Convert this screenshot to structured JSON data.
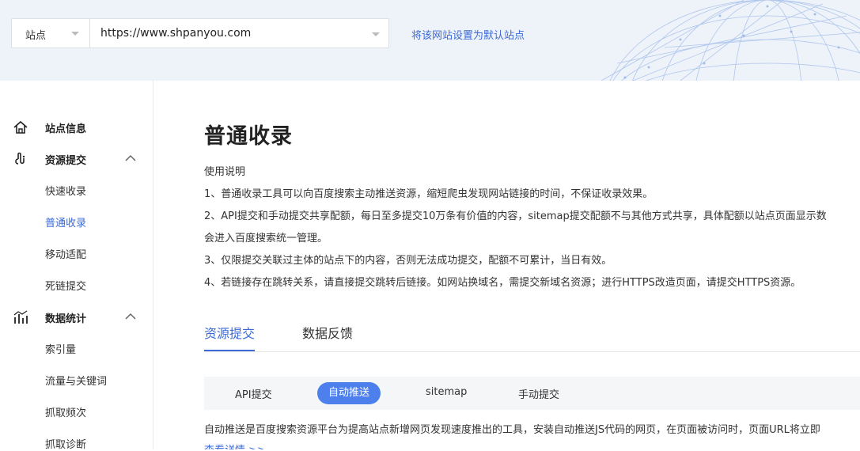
{
  "header": {
    "site_type": "站点",
    "site_url": "https://www.shpanyou.com",
    "set_default": "将该网站设置为默认站点"
  },
  "sidebar": {
    "site_info": "站点信息",
    "resource_submit": "资源提交",
    "resource_items": [
      "快速收录",
      "普通收录",
      "移动适配",
      "死链提交"
    ],
    "data_stats": "数据统计",
    "stats_items": [
      "索引量",
      "流量与关键词",
      "抓取频次",
      "抓取诊断"
    ]
  },
  "main": {
    "title": "普通收录",
    "instructions_title": "使用说明",
    "instructions": [
      "1、普通收录工具可以向百度搜索主动推送资源，缩短爬虫发现网站链接的时间，不保证收录效果。",
      "2、API提交和手动提交共享配额，每日至多提交10万条有价值的内容，sitemap提交配额不与其他方式共享，具体配额以站点页面显示数",
      "会进入百度搜索统一管理。",
      "3、仅限提交关联过主体的站点下的内容，否则无法成功提交，配额不可累计，当日有效。",
      "4、若链接存在跳转关系，请直接提交跳转后链接。如网站换域名，需提交新域名资源；进行HTTPS改造页面，请提交HTTPS资源。"
    ],
    "tabs": [
      "资源提交",
      "数据反馈"
    ],
    "subtabs": [
      "API提交",
      "自动推送",
      "sitemap",
      "手动提交"
    ],
    "description": "自动推送是百度搜索资源平台为提高站点新增网页发现速度推出的工具，安装自动推送JS代码的网页，在页面被访问时，页面URL将立即",
    "more_link": "查看详情 >>"
  },
  "colors": {
    "accent": "#3c6ad6",
    "active_pill": "#4d80ec",
    "header_bg": "#eef2f9"
  }
}
